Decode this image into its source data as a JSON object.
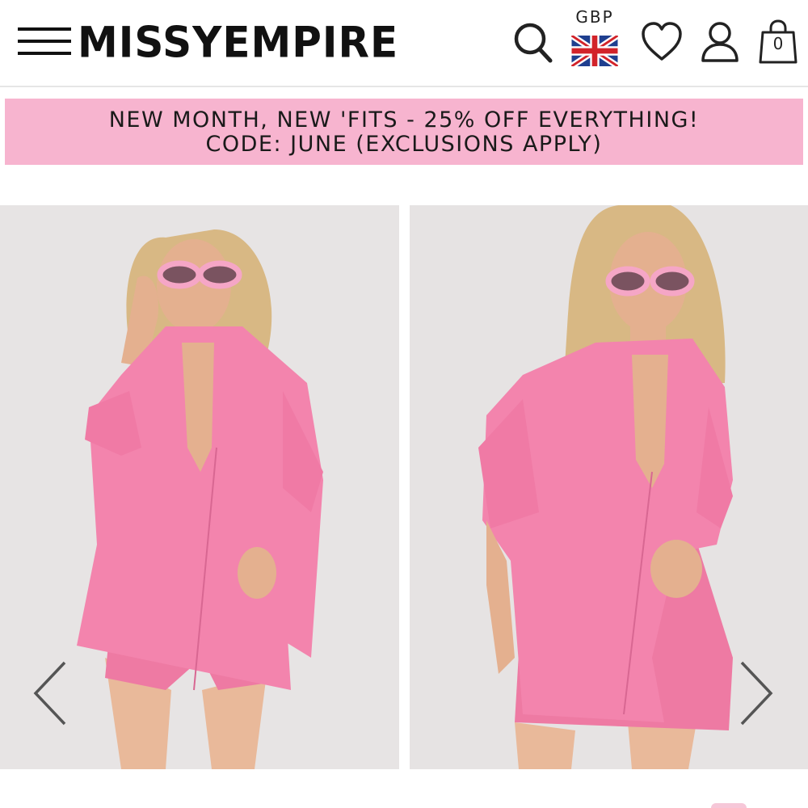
{
  "header": {
    "logo_text": "MISSYEMPIRE",
    "currency": "GBP",
    "bag_count": "0",
    "icons": [
      "menu-icon",
      "search-icon",
      "uk-flag-icon",
      "heart-icon",
      "user-icon",
      "shopping-bag-icon"
    ]
  },
  "promo": {
    "line1": "NEW MONTH, NEW 'FITS - 25% OFF EVERYTHING!",
    "line2": "CODE: JUNE (EXCLUSIONS APPLY)",
    "background": "#f7b4cf"
  },
  "gallery": {
    "images": [
      {
        "alt": "Model wearing pink oversized shirt and shorts co-ord, front view"
      },
      {
        "alt": "Model wearing pink oversized shirt and shorts co-ord, hand on waistband"
      }
    ],
    "prev_icon": "chevron-left-icon",
    "next_icon": "chevron-right-icon"
  },
  "colors": {
    "accent_pink": "#f7b4cf",
    "garment_pink": "#f27fa8",
    "text": "#111111"
  }
}
